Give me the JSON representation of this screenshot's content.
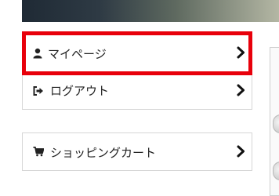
{
  "menu": {
    "items": [
      {
        "label": "マイページ",
        "icon": "user-icon"
      },
      {
        "label": "ログアウト",
        "icon": "sign-out-icon"
      },
      {
        "label": "ショッピングカート",
        "icon": "cart-icon"
      }
    ]
  },
  "colors": {
    "highlight_border": "#e8000b",
    "item_border": "#d6d6d6",
    "text": "#222222"
  }
}
